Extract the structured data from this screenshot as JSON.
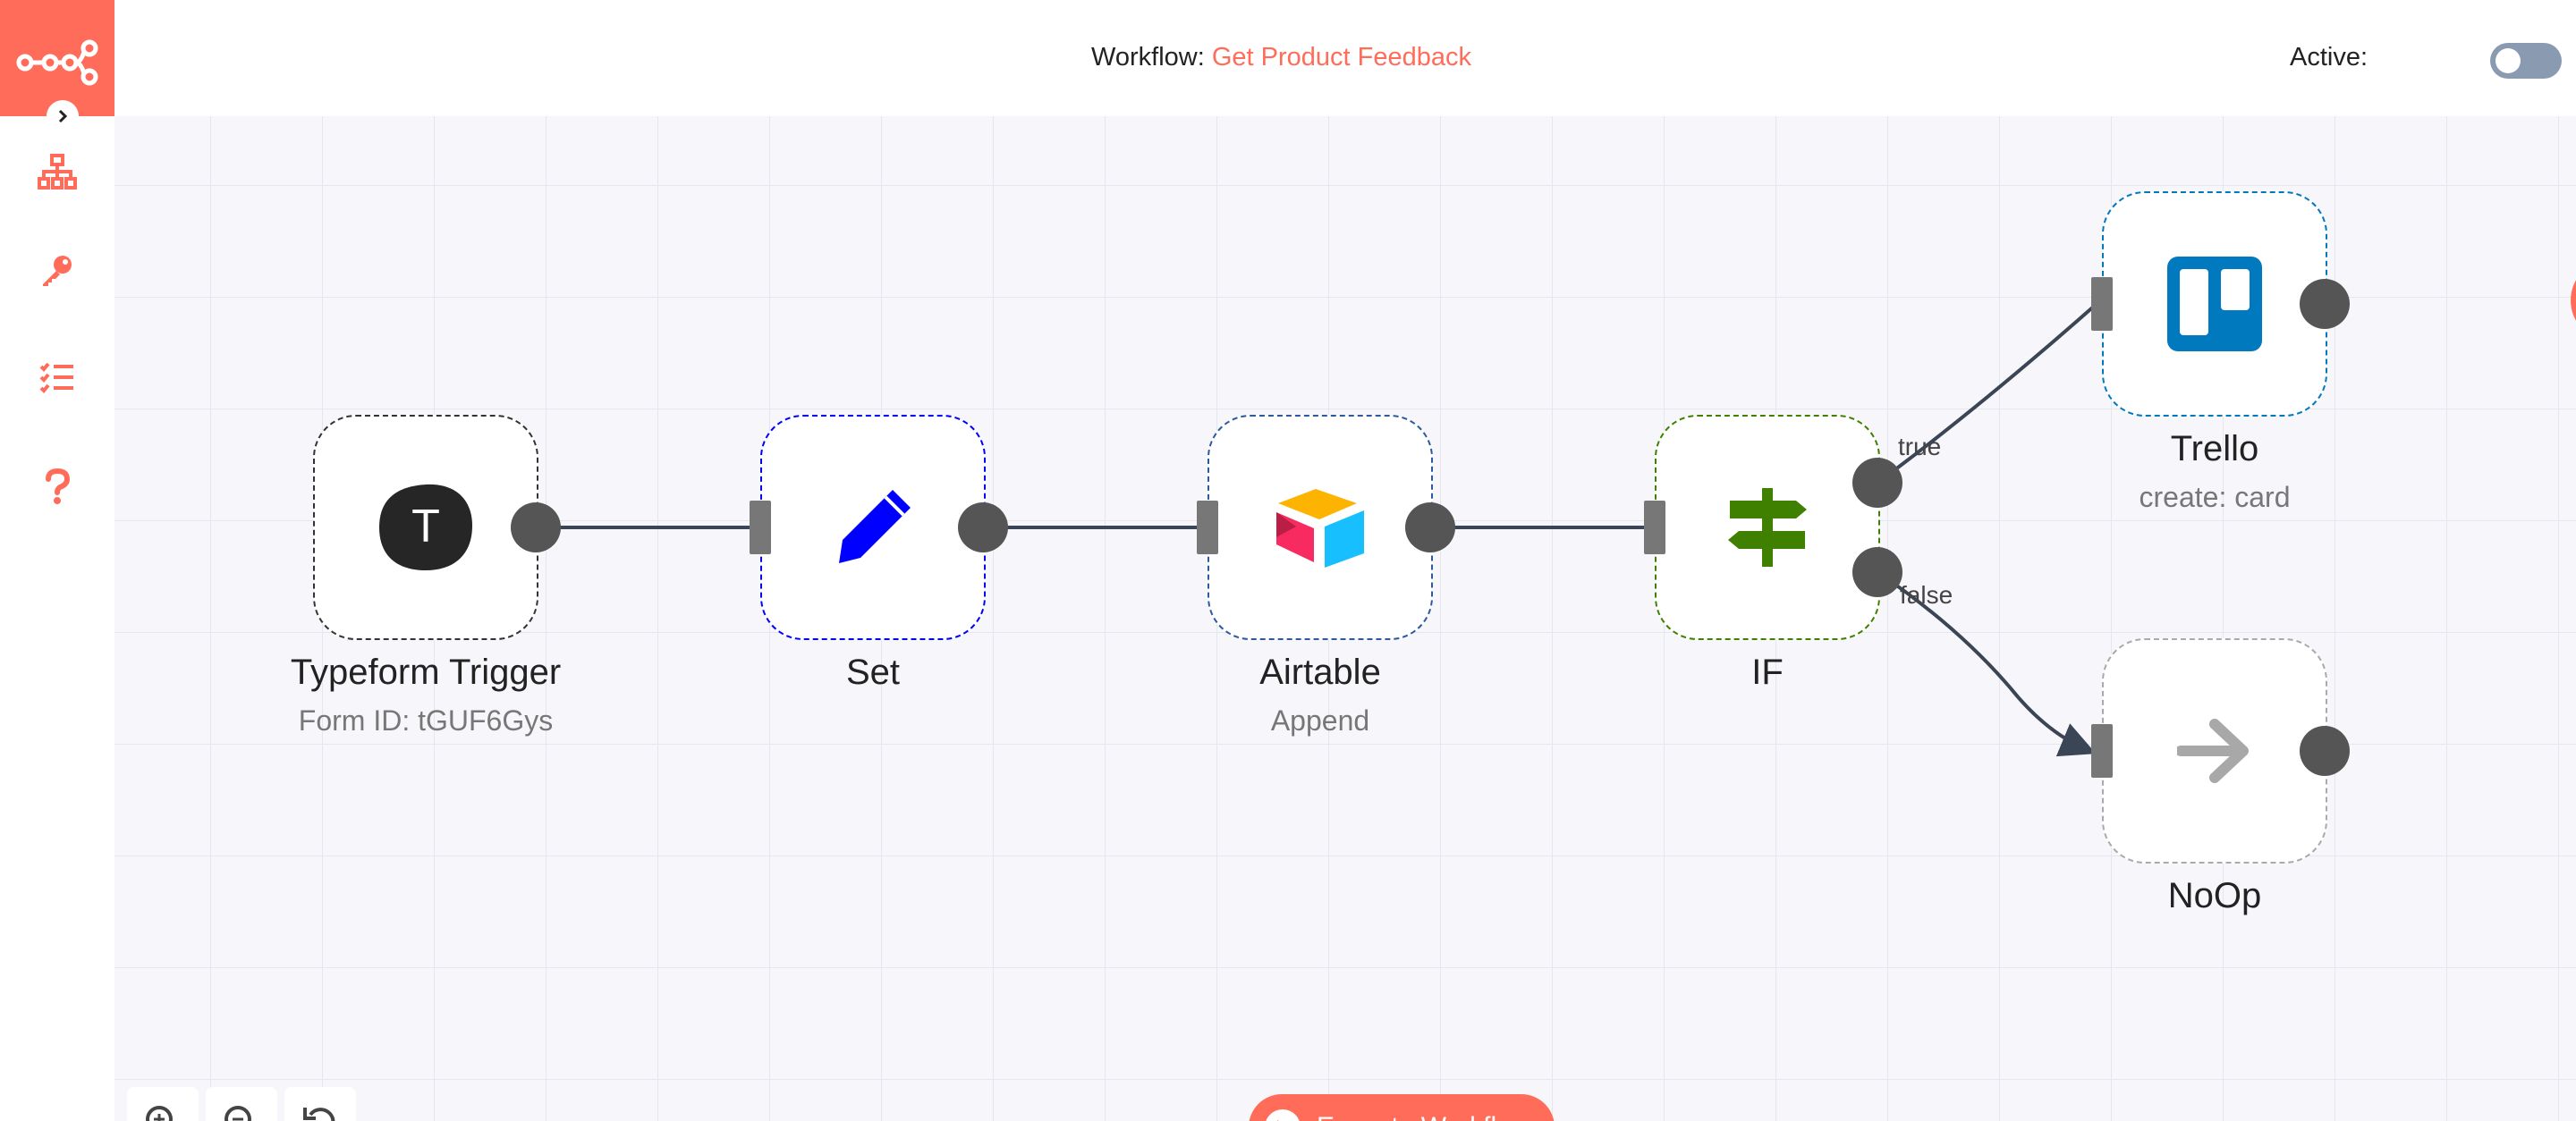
{
  "app": {
    "brand_color": "#ff6d5a",
    "logo_icon": "n8n-logo-icon"
  },
  "header": {
    "workflow_label": "Workflow:",
    "workflow_name": "Get Product Feedback",
    "active_label": "Active:",
    "active_state": false
  },
  "sidebar": {
    "items": [
      {
        "name": "workflows",
        "icon": "network-icon"
      },
      {
        "name": "credentials",
        "icon": "key-icon"
      },
      {
        "name": "executions",
        "icon": "list-check-icon"
      },
      {
        "name": "help",
        "icon": "question-icon"
      }
    ]
  },
  "nodes": [
    {
      "id": "typeform",
      "title": "Typeform Trigger",
      "subtitle": "Form ID: tGUF6Gys",
      "icon": "typeform-icon",
      "border": "#333333"
    },
    {
      "id": "set",
      "title": "Set",
      "subtitle": "",
      "icon": "pencil-icon",
      "border": "#0000ff"
    },
    {
      "id": "airtable",
      "title": "Airtable",
      "subtitle": "Append",
      "icon": "airtable-icon",
      "border": "#2d5a9e"
    },
    {
      "id": "if",
      "title": "IF",
      "subtitle": "",
      "icon": "signpost-icon",
      "border": "#408000"
    },
    {
      "id": "trello",
      "title": "Trello",
      "subtitle": "create: card",
      "icon": "trello-icon",
      "border": "#0079bf"
    },
    {
      "id": "noop",
      "title": "NoOp",
      "subtitle": "",
      "icon": "arrow-right-icon",
      "border": "#aaaaaa"
    }
  ],
  "connection_labels": {
    "true": "true",
    "false": "false"
  },
  "toolbar": {
    "execute_label": "Execute Workflow",
    "zoom_in": "zoom-in-icon",
    "zoom_out": "zoom-out-icon",
    "reset_zoom": "reset-zoom-icon"
  }
}
